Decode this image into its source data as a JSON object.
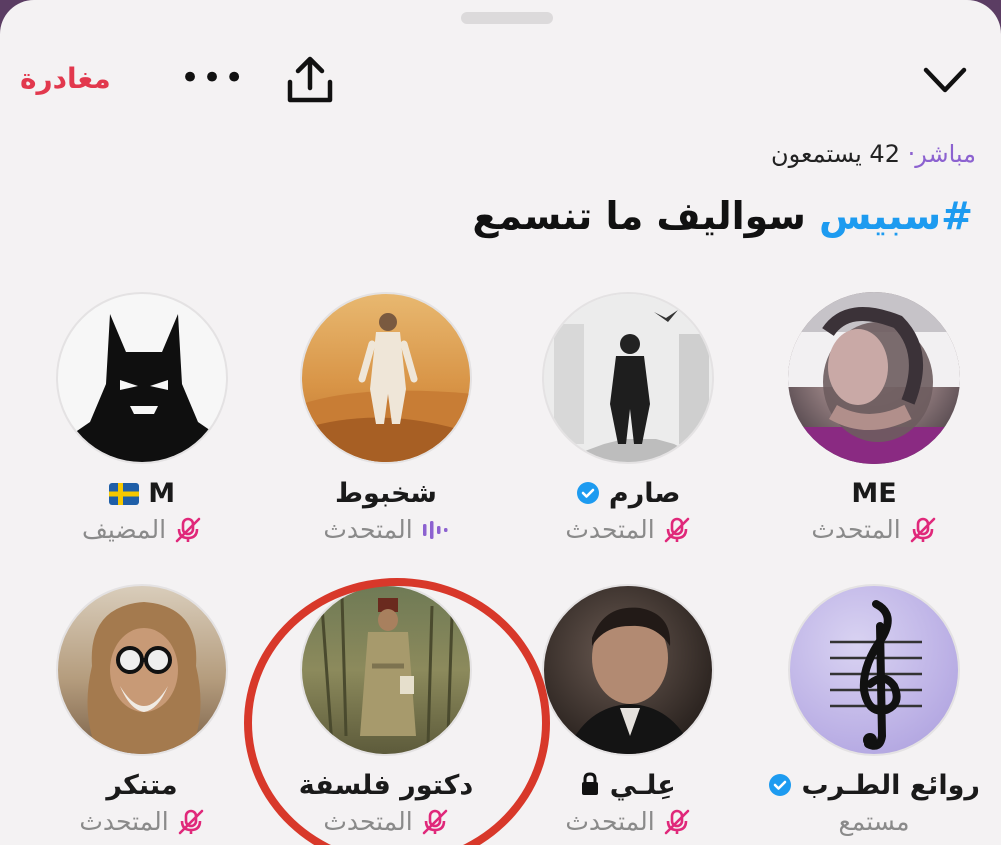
{
  "header": {
    "leave_label": "مغادرة",
    "more_icon": "more-dots-icon",
    "share_icon": "share-icon",
    "collapse_icon": "chevron-down-icon"
  },
  "status": {
    "live_label": "مباشر·",
    "listeners_count": "42",
    "listeners_label": "يستمعون"
  },
  "space": {
    "hashtag": "#سبيس",
    "title": "سواليف ما تنسمع"
  },
  "participants": [
    {
      "name": "ME",
      "role": "المتحدث",
      "verified": false,
      "mic": "muted"
    },
    {
      "name": "صارم",
      "role": "المتحدث",
      "verified": true,
      "mic": "muted"
    },
    {
      "name": "شخبوط",
      "role": "المتحدث",
      "verified": false,
      "mic": "speaking"
    },
    {
      "name": "M",
      "flag": "🇸🇪",
      "role": "المضيف",
      "verified": false,
      "mic": "muted"
    },
    {
      "name": "روائع الطـرب",
      "role": "مستمع",
      "verified": true,
      "mic": "none"
    },
    {
      "name": "عِلـي",
      "role": "المتحدث",
      "verified": false,
      "locked": true,
      "mic": "muted"
    },
    {
      "name": "دكتور فلسفة",
      "role": "المتحدث",
      "verified": false,
      "mic": "muted"
    },
    {
      "name": "متنكر",
      "role": "المتحدث",
      "verified": false,
      "mic": "muted"
    }
  ],
  "colors": {
    "accent_red": "#e2384d",
    "accent_purple": "#8c62d0",
    "hashtag_blue": "#1d9bf0",
    "mute_pink": "#e0287a",
    "annotation_red": "#d8382a"
  }
}
